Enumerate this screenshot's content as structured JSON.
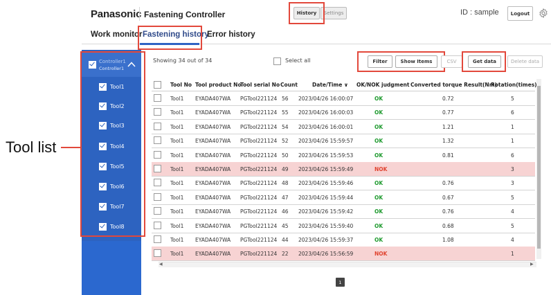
{
  "header": {
    "brand": "Panasonic",
    "app_title": "Fastening Controller",
    "history_label": "History",
    "settings_label": "Settings",
    "user_id": "ID : sample",
    "logout_label": "Logout"
  },
  "tabs": [
    {
      "label": "Work monitor"
    },
    {
      "label": "Fastening history"
    },
    {
      "label": "Error history"
    }
  ],
  "sidebar": {
    "controller_name": "Controller1",
    "controller_sub": "Controller1",
    "tools": [
      {
        "label": "Tool1"
      },
      {
        "label": "Tool2"
      },
      {
        "label": "Tool3"
      },
      {
        "label": "Tool4"
      },
      {
        "label": "Tool5"
      },
      {
        "label": "Tool6"
      },
      {
        "label": "Tool7"
      },
      {
        "label": "Tool8"
      }
    ]
  },
  "annotation": "Tool list",
  "toolbar": {
    "showing": "Showing 34 out of 34",
    "select_all": "Select all",
    "filter": "Filter",
    "show_items": "Show Items",
    "csv": "CSV",
    "get_data": "Get data",
    "delete_data": "Delete data"
  },
  "table": {
    "headers": [
      "Tool No",
      "Tool product No",
      "Tool serial No",
      "Count",
      "Date/Time ∨",
      "OK/NOK judgment",
      "Converted torque Result(Nm)",
      "Rotation(times)"
    ],
    "rows": [
      {
        "tool": "Tool1",
        "product": "EYADA407WA",
        "serial": "PGTool221124",
        "count": "56",
        "datetime": "2023/04/26 16:00:07",
        "judgment": "OK",
        "torque": "0.72",
        "rotation": "5"
      },
      {
        "tool": "Tool1",
        "product": "EYADA407WA",
        "serial": "PGTool221124",
        "count": "55",
        "datetime": "2023/04/26 16:00:03",
        "judgment": "OK",
        "torque": "0.77",
        "rotation": "6"
      },
      {
        "tool": "Tool1",
        "product": "EYADA407WA",
        "serial": "PGTool221124",
        "count": "54",
        "datetime": "2023/04/26 16:00:01",
        "judgment": "OK",
        "torque": "1.21",
        "rotation": "1"
      },
      {
        "tool": "Tool1",
        "product": "EYADA407WA",
        "serial": "PGTool221124",
        "count": "52",
        "datetime": "2023/04/26 15:59:57",
        "judgment": "OK",
        "torque": "1.32",
        "rotation": "1"
      },
      {
        "tool": "Tool1",
        "product": "EYADA407WA",
        "serial": "PGTool221124",
        "count": "50",
        "datetime": "2023/04/26 15:59:53",
        "judgment": "OK",
        "torque": "0.81",
        "rotation": "6"
      },
      {
        "tool": "Tool1",
        "product": "EYADA407WA",
        "serial": "PGTool221124",
        "count": "49",
        "datetime": "2023/04/26 15:59:49",
        "judgment": "NOK",
        "torque": "",
        "rotation": "3"
      },
      {
        "tool": "Tool1",
        "product": "EYADA407WA",
        "serial": "PGTool221124",
        "count": "48",
        "datetime": "2023/04/26 15:59:46",
        "judgment": "OK",
        "torque": "0.76",
        "rotation": "3"
      },
      {
        "tool": "Tool1",
        "product": "EYADA407WA",
        "serial": "PGTool221124",
        "count": "47",
        "datetime": "2023/04/26 15:59:44",
        "judgment": "OK",
        "torque": "0.67",
        "rotation": "5"
      },
      {
        "tool": "Tool1",
        "product": "EYADA407WA",
        "serial": "PGTool221124",
        "count": "46",
        "datetime": "2023/04/26 15:59:42",
        "judgment": "OK",
        "torque": "0.76",
        "rotation": "4"
      },
      {
        "tool": "Tool1",
        "product": "EYADA407WA",
        "serial": "PGTool221124",
        "count": "45",
        "datetime": "2023/04/26 15:59:40",
        "judgment": "OK",
        "torque": "0.68",
        "rotation": "5"
      },
      {
        "tool": "Tool1",
        "product": "EYADA407WA",
        "serial": "PGTool221124",
        "count": "44",
        "datetime": "2023/04/26 15:59:37",
        "judgment": "OK",
        "torque": "1.08",
        "rotation": "4"
      },
      {
        "tool": "Tool1",
        "product": "EYADA407WA",
        "serial": "PGTool221124",
        "count": "22",
        "datetime": "2023/04/26 15:56:59",
        "judgment": "NOK",
        "torque": "",
        "rotation": "1"
      }
    ]
  },
  "pagination": {
    "current_page": "1"
  },
  "colors": {
    "accent_red": "#e2483b",
    "sidebar_blue": "#2d63c0",
    "ok_green": "#1e9a2e",
    "nok_red": "#e0432f",
    "nok_row_bg": "#f7d3d3"
  }
}
